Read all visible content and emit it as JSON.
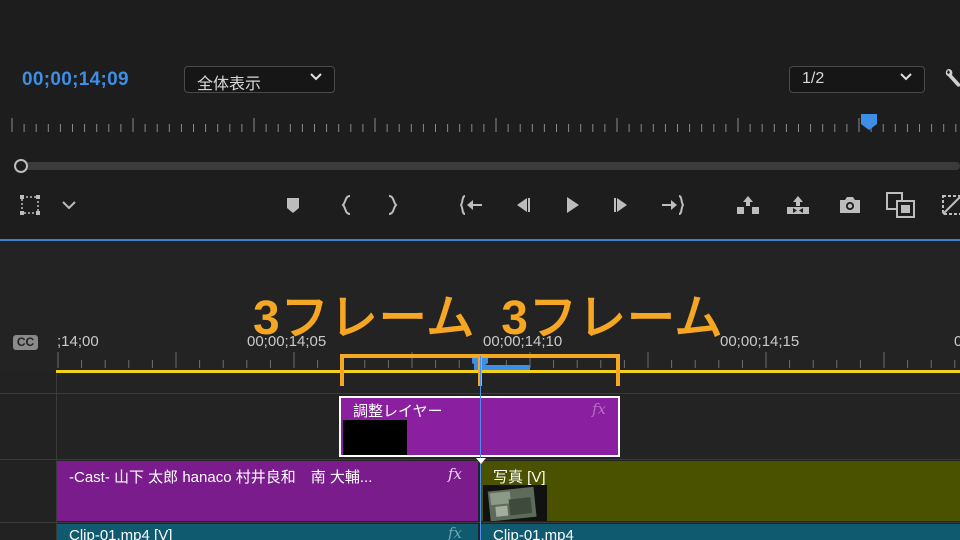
{
  "monitor": {
    "timecode": "00;00;14;09",
    "zoom_select": "全体表示",
    "resolution_select": "1/2",
    "icons": [
      "wrench-icon",
      "safe-margins-icon",
      "chevron-down-icon",
      "add-marker-icon",
      "mark-in-icon",
      "mark-out-icon",
      "go-to-in-icon",
      "step-back-icon",
      "play-icon",
      "step-forward-icon",
      "go-to-out-icon",
      "lift-icon",
      "extract-icon",
      "export-frame-icon",
      "comparison-view-icon",
      "toggle-proxies-icon"
    ]
  },
  "overlay": {
    "left_text": "3フレーム",
    "right_text": "3フレーム",
    "color": "#f5a623"
  },
  "timeline": {
    "cc_label": "CC",
    "ruler_labels": [
      ";14;00",
      "00;00;14;05",
      "00;00;14;10",
      "00;00;14;15",
      "0"
    ],
    "clips": {
      "adjustment": {
        "name": "調整レイヤー",
        "fx": "fx"
      },
      "cast": {
        "name": "-Cast- 山下 太郎 hanaco 村井良和　南 大輔...",
        "fx": "fx"
      },
      "photo": {
        "name": "写真 [V]"
      },
      "clip1_left": {
        "name": "Clip-01.mp4 [V]",
        "fx": "fx"
      },
      "clip1_right": {
        "name": "Clip-01.mp4"
      }
    },
    "colors": {
      "playhead": "#4a8ef0",
      "work_area": "#f2d21b",
      "adjustment_clip": "#8a1fa0",
      "cast_clip": "#7a1c8c",
      "photo_clip": "#4a5200",
      "video_clip": "#0f5a6e"
    }
  }
}
